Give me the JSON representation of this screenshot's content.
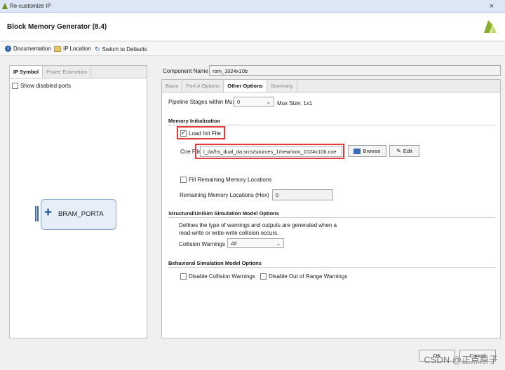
{
  "window": {
    "title": "Re-customize IP",
    "close_glyph": "×"
  },
  "header": {
    "title": "Block Memory Generator (8.4)"
  },
  "toolbar": {
    "documentation": "Documentation",
    "ip_location": "IP Location",
    "switch_defaults": "Switch to Defaults"
  },
  "left": {
    "tabs": [
      "IP Symbol",
      "Power Estimation"
    ],
    "show_disabled_ports": "Show disabled ports",
    "port_label": "BRAM_PORTA",
    "port_plus": "+"
  },
  "component": {
    "label": "Component Name",
    "value": "rom_1024x10b"
  },
  "right_tabs": [
    "Basic",
    "Port A Options",
    "Other Options",
    "Summary"
  ],
  "pipeline": {
    "label": "Pipeline Stages within Mux",
    "value": "0",
    "mux_size": "Mux Size: 1x1"
  },
  "memory_init": {
    "title": "Memory Initialization",
    "load_init_file": "Load Init File",
    "coe_label": "Coe File",
    "coe_value": "l_da/hs_dual_da.srcs/sources_1/new/rom_1024x10b.coe",
    "browse": "Browse",
    "edit": "Edit",
    "fill_remaining": "Fill Remaining Memory Locations",
    "remaining_label": "Remaining Memory Locations (Hex)",
    "remaining_value": "0"
  },
  "structural": {
    "title": "Structural/UniSim Simulation Model Options",
    "desc1": "Defines the type of warnings and outputs are generated when a",
    "desc2": "read-write or write-write collision occurs.",
    "collision_label": "Collision Warnings",
    "collision_value": "All"
  },
  "behavioral": {
    "title": "Behavioral Simulation Model Options",
    "disable_collision": "Disable Collision Warnings",
    "disable_range": "Disable Out of Range Warnings"
  },
  "footer": {
    "ok": "OK",
    "cancel": "Cancel",
    "watermark": "CSDN @正点原子"
  },
  "colors": {
    "highlight": "#e23b3b",
    "brand": "#8ab02b"
  }
}
